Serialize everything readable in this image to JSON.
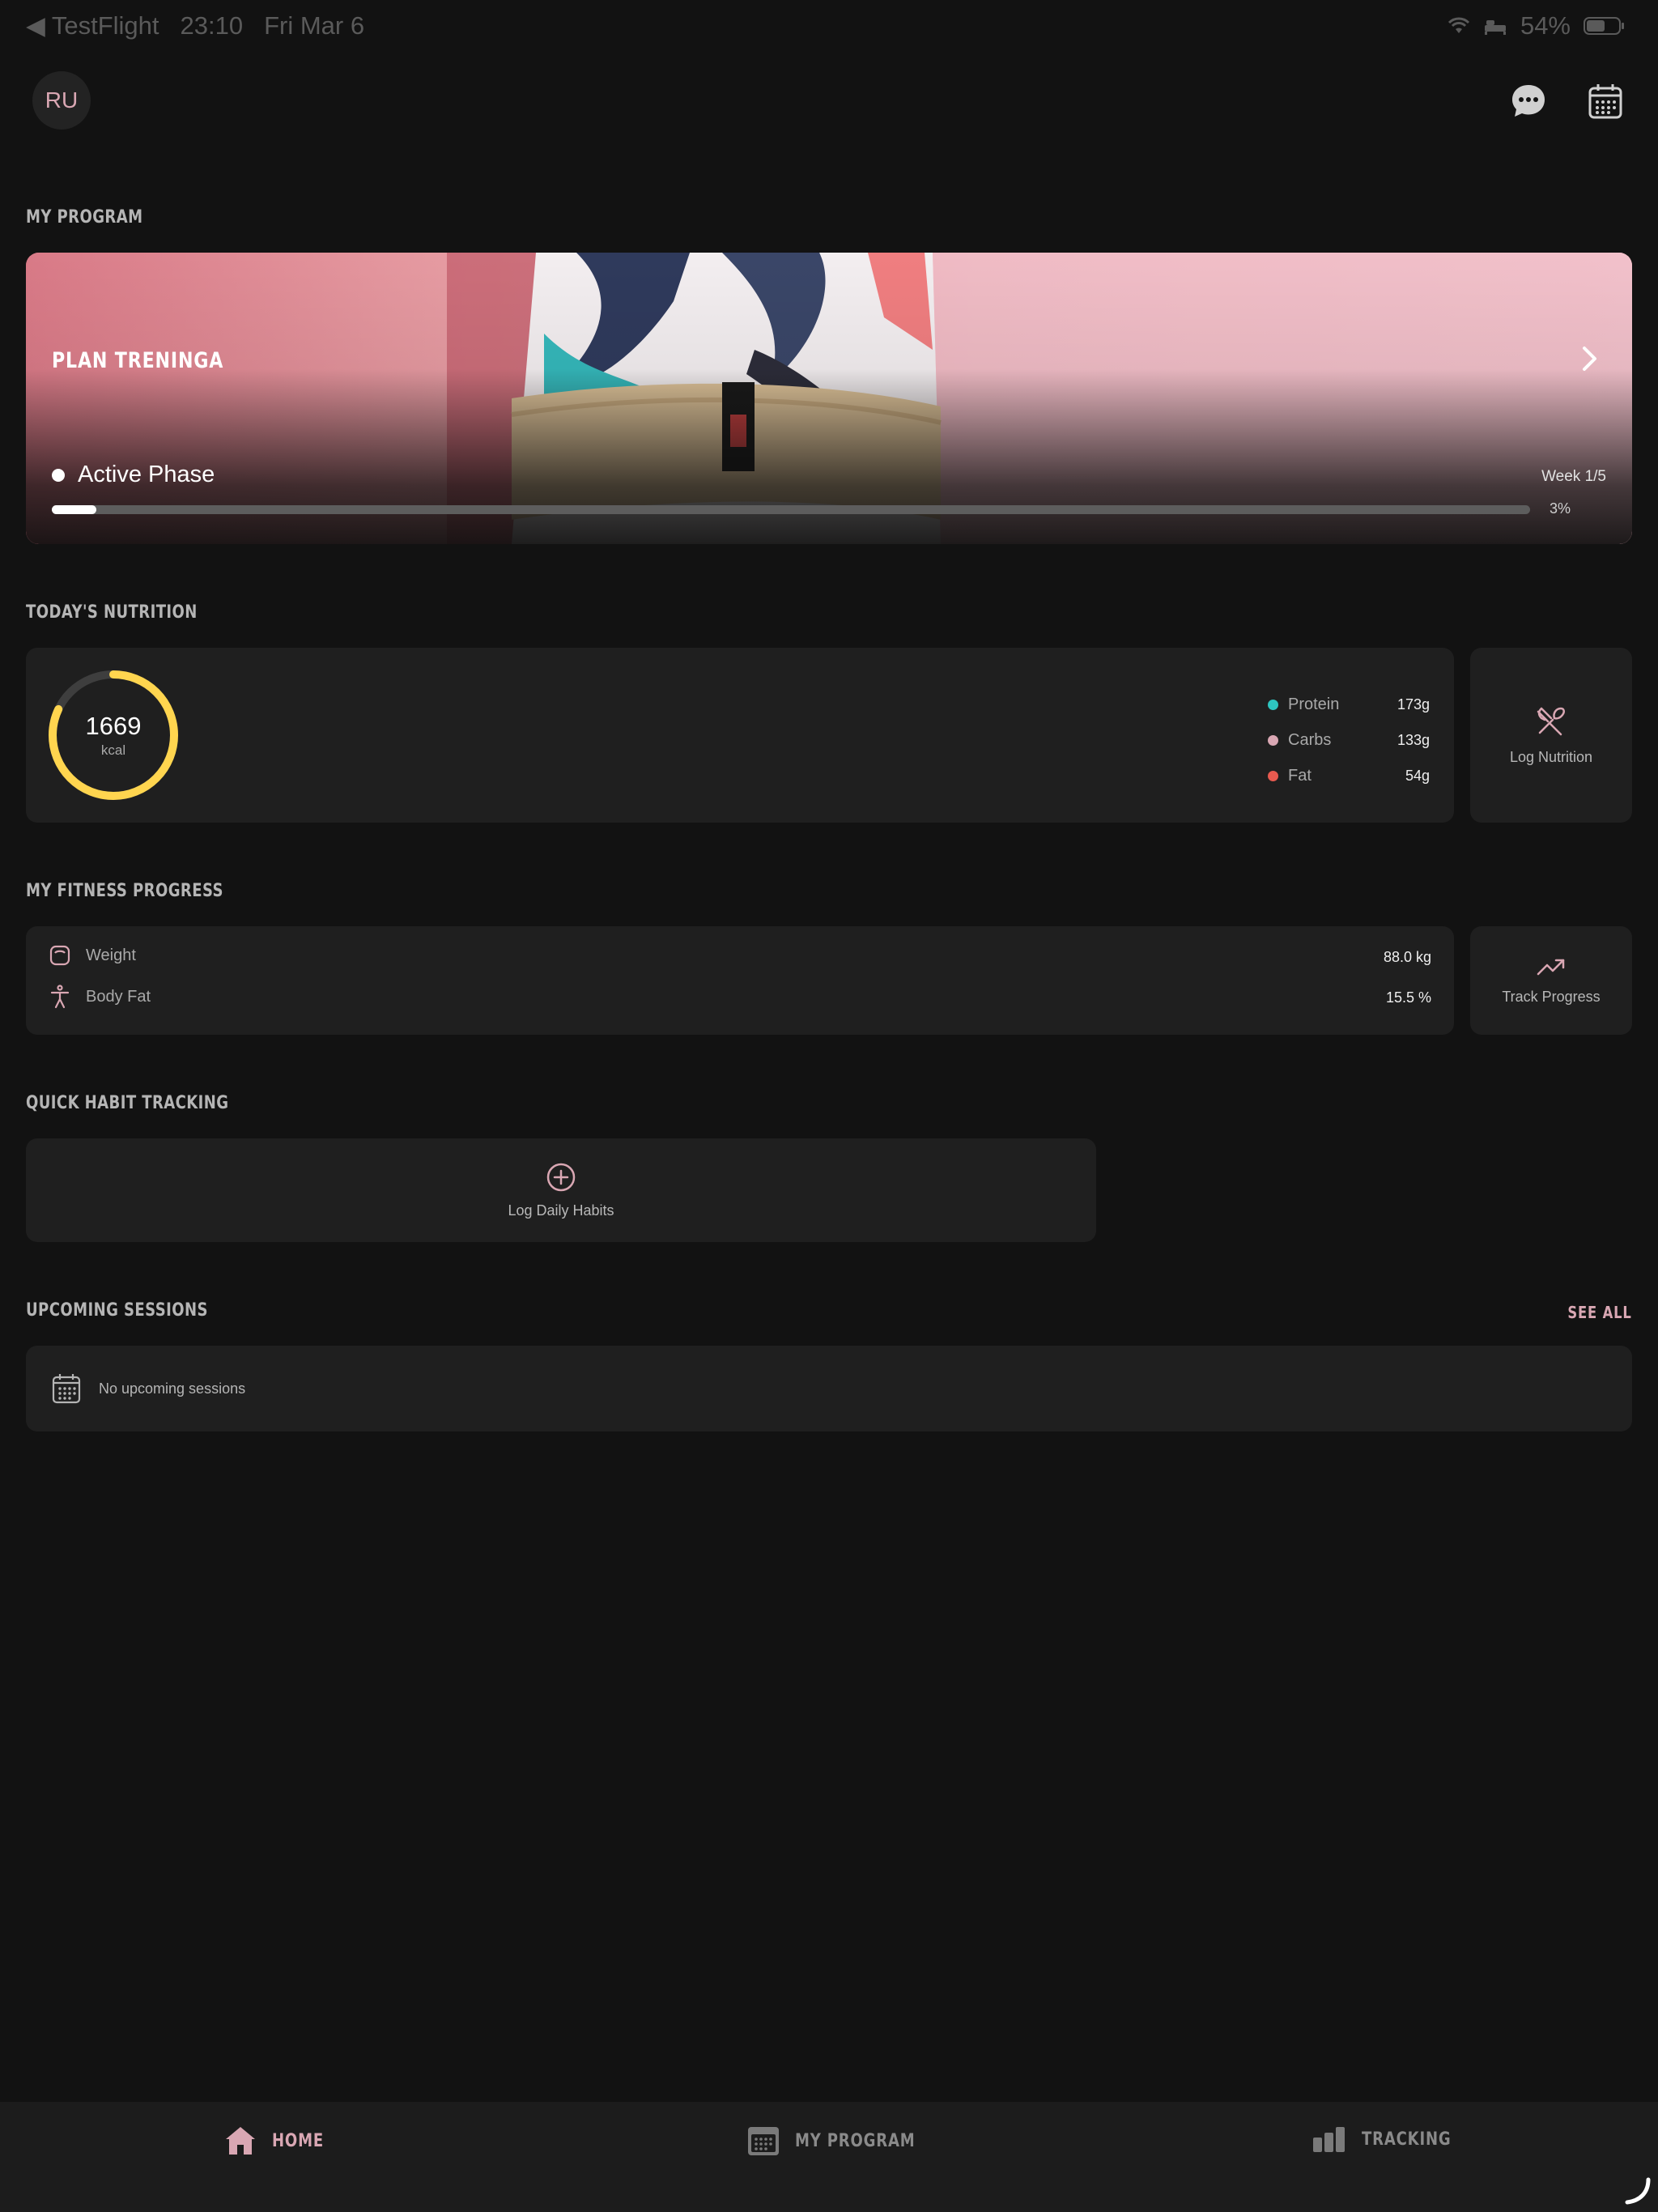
{
  "status_bar": {
    "back_app": "TestFlight",
    "time": "23:10",
    "date": "Fri Mar 6",
    "battery": "54%"
  },
  "header": {
    "avatar_initials": "RU",
    "icons": [
      "chat-icon",
      "calendar-icon"
    ]
  },
  "program": {
    "section_title": "MY PROGRAM",
    "plan_title": "PLAN TRENINGA",
    "phase_label": "Active Phase",
    "week_label": "Week 1/5",
    "progress_label": "3%",
    "progress": 0.03
  },
  "nutrition": {
    "section_title": "TODAY'S NUTRITION",
    "kcal": "1669",
    "kcal_unit": "kcal",
    "ring_progress": 0.82,
    "macros": [
      {
        "name": "Protein",
        "value": "173g",
        "color": "#2ec5c0"
      },
      {
        "name": "Carbs",
        "value": "133g",
        "color": "#d9a7b3"
      },
      {
        "name": "Fat",
        "value": "54g",
        "color": "#e85a4f"
      }
    ],
    "log_label": "Log Nutrition"
  },
  "fitness": {
    "section_title": "MY FITNESS PROGRESS",
    "rows": [
      {
        "label": "Weight",
        "value": "88.0 kg"
      },
      {
        "label": "Body Fat",
        "value": "15.5 %"
      }
    ],
    "track_label": "Track Progress"
  },
  "habits": {
    "section_title": "QUICK HABIT TRACKING",
    "log_label": "Log Daily Habits"
  },
  "sessions": {
    "section_title": "UPCOMING SESSIONS",
    "see_all": "SEE ALL",
    "empty_label": "No upcoming sessions"
  },
  "nav": {
    "home": "HOME",
    "program": "MY PROGRAM",
    "tracking": "TRACKING"
  },
  "colors": {
    "accent": "#d9a7b3",
    "ring": "#ffd54f",
    "background": "#121212",
    "card": "#1f1f1f"
  }
}
